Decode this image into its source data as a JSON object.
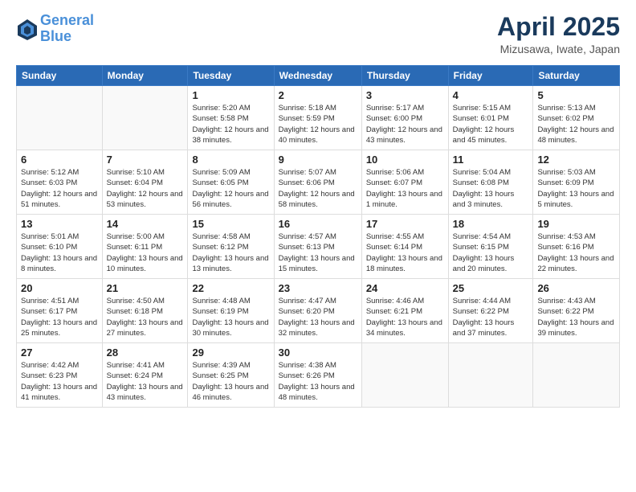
{
  "header": {
    "logo_line1": "General",
    "logo_line2": "Blue",
    "title": "April 2025",
    "location": "Mizusawa, Iwate, Japan"
  },
  "weekdays": [
    "Sunday",
    "Monday",
    "Tuesday",
    "Wednesday",
    "Thursday",
    "Friday",
    "Saturday"
  ],
  "weeks": [
    [
      {
        "day": "",
        "info": ""
      },
      {
        "day": "",
        "info": ""
      },
      {
        "day": "1",
        "info": "Sunrise: 5:20 AM\nSunset: 5:58 PM\nDaylight: 12 hours\nand 38 minutes."
      },
      {
        "day": "2",
        "info": "Sunrise: 5:18 AM\nSunset: 5:59 PM\nDaylight: 12 hours\nand 40 minutes."
      },
      {
        "day": "3",
        "info": "Sunrise: 5:17 AM\nSunset: 6:00 PM\nDaylight: 12 hours\nand 43 minutes."
      },
      {
        "day": "4",
        "info": "Sunrise: 5:15 AM\nSunset: 6:01 PM\nDaylight: 12 hours\nand 45 minutes."
      },
      {
        "day": "5",
        "info": "Sunrise: 5:13 AM\nSunset: 6:02 PM\nDaylight: 12 hours\nand 48 minutes."
      }
    ],
    [
      {
        "day": "6",
        "info": "Sunrise: 5:12 AM\nSunset: 6:03 PM\nDaylight: 12 hours\nand 51 minutes."
      },
      {
        "day": "7",
        "info": "Sunrise: 5:10 AM\nSunset: 6:04 PM\nDaylight: 12 hours\nand 53 minutes."
      },
      {
        "day": "8",
        "info": "Sunrise: 5:09 AM\nSunset: 6:05 PM\nDaylight: 12 hours\nand 56 minutes."
      },
      {
        "day": "9",
        "info": "Sunrise: 5:07 AM\nSunset: 6:06 PM\nDaylight: 12 hours\nand 58 minutes."
      },
      {
        "day": "10",
        "info": "Sunrise: 5:06 AM\nSunset: 6:07 PM\nDaylight: 13 hours\nand 1 minute."
      },
      {
        "day": "11",
        "info": "Sunrise: 5:04 AM\nSunset: 6:08 PM\nDaylight: 13 hours\nand 3 minutes."
      },
      {
        "day": "12",
        "info": "Sunrise: 5:03 AM\nSunset: 6:09 PM\nDaylight: 13 hours\nand 5 minutes."
      }
    ],
    [
      {
        "day": "13",
        "info": "Sunrise: 5:01 AM\nSunset: 6:10 PM\nDaylight: 13 hours\nand 8 minutes."
      },
      {
        "day": "14",
        "info": "Sunrise: 5:00 AM\nSunset: 6:11 PM\nDaylight: 13 hours\nand 10 minutes."
      },
      {
        "day": "15",
        "info": "Sunrise: 4:58 AM\nSunset: 6:12 PM\nDaylight: 13 hours\nand 13 minutes."
      },
      {
        "day": "16",
        "info": "Sunrise: 4:57 AM\nSunset: 6:13 PM\nDaylight: 13 hours\nand 15 minutes."
      },
      {
        "day": "17",
        "info": "Sunrise: 4:55 AM\nSunset: 6:14 PM\nDaylight: 13 hours\nand 18 minutes."
      },
      {
        "day": "18",
        "info": "Sunrise: 4:54 AM\nSunset: 6:15 PM\nDaylight: 13 hours\nand 20 minutes."
      },
      {
        "day": "19",
        "info": "Sunrise: 4:53 AM\nSunset: 6:16 PM\nDaylight: 13 hours\nand 22 minutes."
      }
    ],
    [
      {
        "day": "20",
        "info": "Sunrise: 4:51 AM\nSunset: 6:17 PM\nDaylight: 13 hours\nand 25 minutes."
      },
      {
        "day": "21",
        "info": "Sunrise: 4:50 AM\nSunset: 6:18 PM\nDaylight: 13 hours\nand 27 minutes."
      },
      {
        "day": "22",
        "info": "Sunrise: 4:48 AM\nSunset: 6:19 PM\nDaylight: 13 hours\nand 30 minutes."
      },
      {
        "day": "23",
        "info": "Sunrise: 4:47 AM\nSunset: 6:20 PM\nDaylight: 13 hours\nand 32 minutes."
      },
      {
        "day": "24",
        "info": "Sunrise: 4:46 AM\nSunset: 6:21 PM\nDaylight: 13 hours\nand 34 minutes."
      },
      {
        "day": "25",
        "info": "Sunrise: 4:44 AM\nSunset: 6:22 PM\nDaylight: 13 hours\nand 37 minutes."
      },
      {
        "day": "26",
        "info": "Sunrise: 4:43 AM\nSunset: 6:22 PM\nDaylight: 13 hours\nand 39 minutes."
      }
    ],
    [
      {
        "day": "27",
        "info": "Sunrise: 4:42 AM\nSunset: 6:23 PM\nDaylight: 13 hours\nand 41 minutes."
      },
      {
        "day": "28",
        "info": "Sunrise: 4:41 AM\nSunset: 6:24 PM\nDaylight: 13 hours\nand 43 minutes."
      },
      {
        "day": "29",
        "info": "Sunrise: 4:39 AM\nSunset: 6:25 PM\nDaylight: 13 hours\nand 46 minutes."
      },
      {
        "day": "30",
        "info": "Sunrise: 4:38 AM\nSunset: 6:26 PM\nDaylight: 13 hours\nand 48 minutes."
      },
      {
        "day": "",
        "info": ""
      },
      {
        "day": "",
        "info": ""
      },
      {
        "day": "",
        "info": ""
      }
    ]
  ]
}
